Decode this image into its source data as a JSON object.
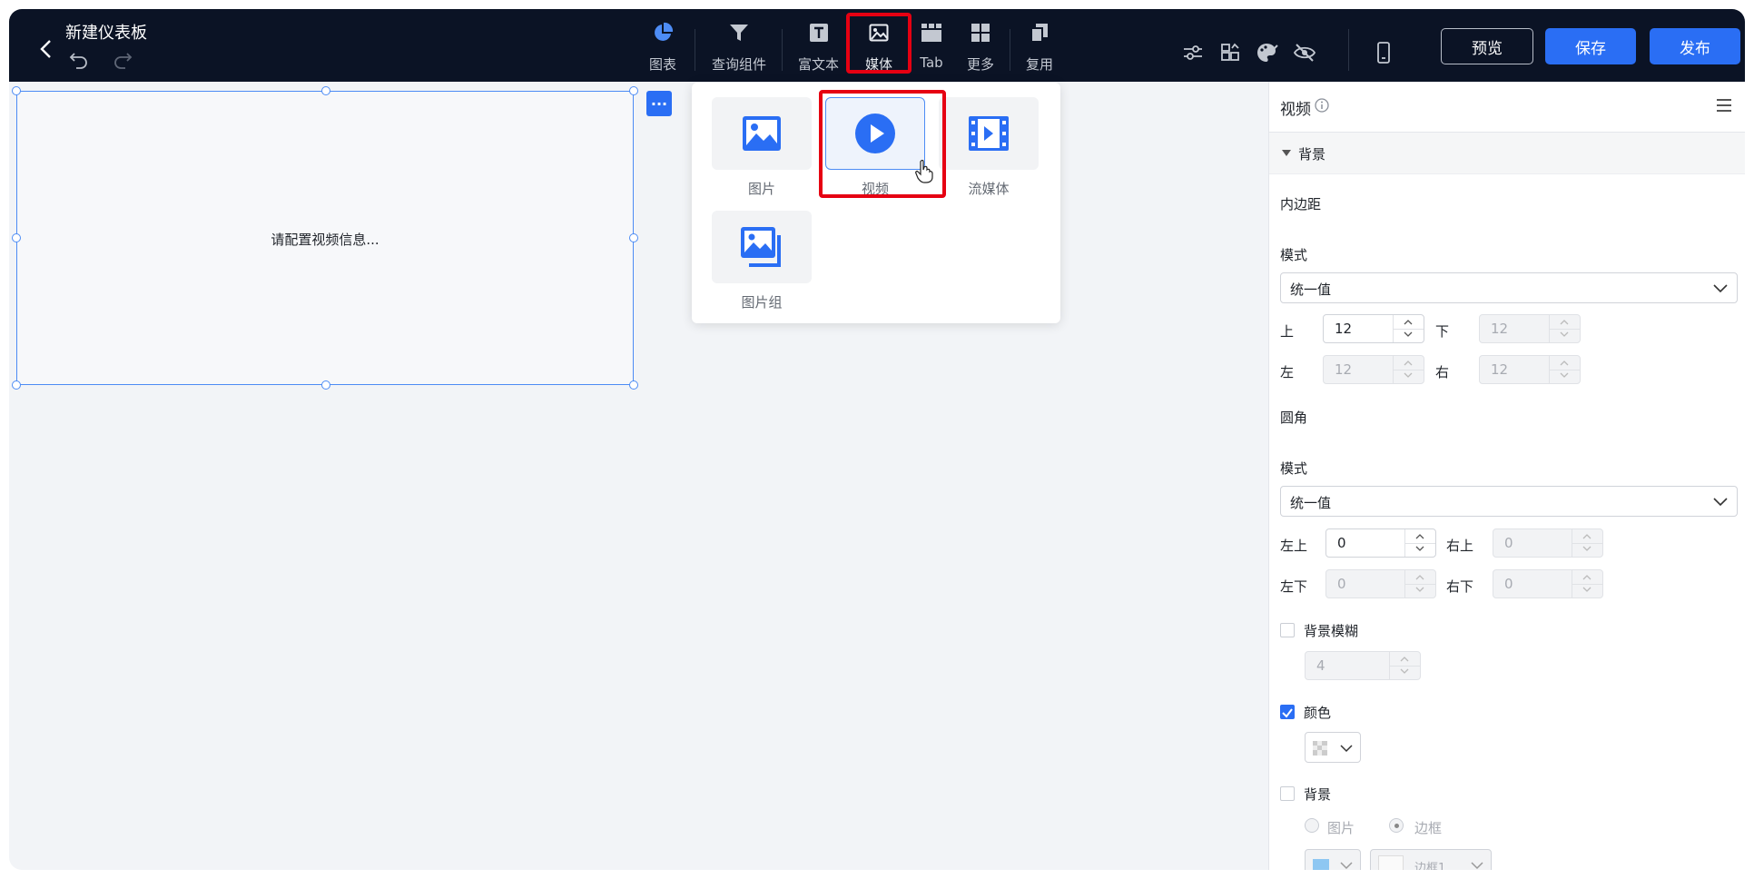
{
  "header": {
    "title": "新建仪表板",
    "tools": [
      {
        "label": "图表",
        "icon": "pie-chart-icon"
      },
      {
        "label": "查询组件",
        "icon": "filter-icon"
      },
      {
        "label": "富文本",
        "icon": "text-icon"
      },
      {
        "label": "媒体",
        "icon": "image-icon"
      },
      {
        "label": "Tab",
        "icon": "tab-icon"
      },
      {
        "label": "更多",
        "icon": "grid-icon"
      },
      {
        "label": "复用",
        "icon": "copy-icon"
      }
    ],
    "buttons": {
      "preview": "预览",
      "save": "保存",
      "publish": "发布"
    }
  },
  "canvas": {
    "widget_message": "请配置视频信息...",
    "more_label": "···"
  },
  "media_menu": {
    "items": [
      {
        "label": "图片",
        "icon": "picture-icon"
      },
      {
        "label": "视频",
        "icon": "play-icon"
      },
      {
        "label": "流媒体",
        "icon": "film-icon"
      },
      {
        "label": "图片组",
        "icon": "picture-group-icon"
      }
    ]
  },
  "panel": {
    "title": "视频",
    "section": "背景",
    "padding": {
      "label": "内边距",
      "mode_label": "模式",
      "mode_value": "统一值",
      "top_label": "上",
      "top_value": "12",
      "bottom_label": "下",
      "bottom_value": "12",
      "left_label": "左",
      "left_value": "12",
      "right_label": "右",
      "right_value": "12"
    },
    "radius": {
      "label": "圆角",
      "mode_label": "模式",
      "mode_value": "统一值",
      "tl_label": "左上",
      "tl_value": "0",
      "tr_label": "右上",
      "tr_value": "0",
      "bl_label": "左下",
      "bl_value": "0",
      "br_label": "右下",
      "br_value": "0"
    },
    "blur": {
      "label": "背景模糊",
      "value": "4",
      "checked": false
    },
    "color": {
      "label": "颜色",
      "checked": true
    },
    "background": {
      "label": "背景",
      "checked": false,
      "option_image": "图片",
      "option_border": "边框",
      "border_value": "边框1",
      "swatch_color": "#8ec7f2"
    }
  },
  "colors": {
    "accent": "#2a6ef4",
    "header_bg": "#0b1325",
    "highlight": "#e60012"
  }
}
